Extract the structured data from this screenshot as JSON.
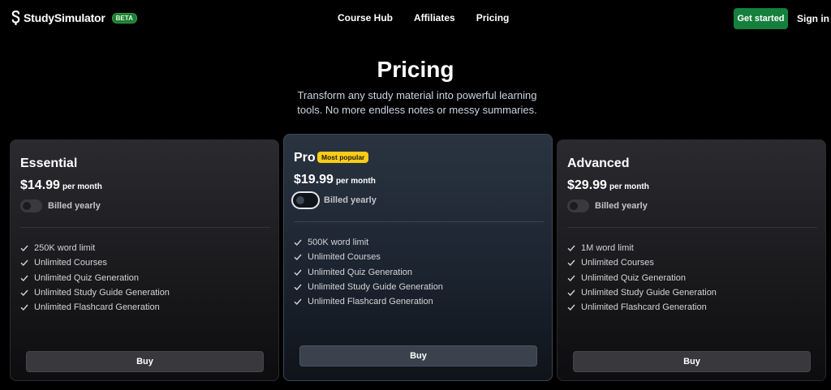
{
  "header": {
    "logo_text": "StudySimulator",
    "beta_label": "BETA",
    "nav": [
      "Course Hub",
      "Affiliates",
      "Pricing"
    ],
    "get_started": "Get started",
    "sign_in": "Sign in"
  },
  "hero": {
    "title": "Pricing",
    "subtitle": "Transform any study material into powerful learning tools. No more endless notes or messy summaries."
  },
  "plans": [
    {
      "name": "Essential",
      "price": "$14.99",
      "period": "per month",
      "billing_label": "Billed yearly",
      "billed_yearly": false,
      "features": [
        "250K word limit",
        "Unlimited Courses",
        "Unlimited Quiz Generation",
        "Unlimited Study Guide Generation",
        "Unlimited Flashcard Generation"
      ],
      "buy_label": "Buy"
    },
    {
      "name": "Pro",
      "badge": "Most popular",
      "price": "$19.99",
      "period": "per month",
      "billing_label": "Billed yearly",
      "billed_yearly": false,
      "features": [
        "500K word limit",
        "Unlimited Courses",
        "Unlimited Quiz Generation",
        "Unlimited Study Guide Generation",
        "Unlimited Flashcard Generation"
      ],
      "buy_label": "Buy"
    },
    {
      "name": "Advanced",
      "price": "$29.99",
      "period": "per month",
      "billing_label": "Billed yearly",
      "billed_yearly": false,
      "features": [
        "1M word limit",
        "Unlimited Courses",
        "Unlimited Quiz Generation",
        "Unlimited Study Guide Generation",
        "Unlimited Flashcard Generation"
      ],
      "buy_label": "Buy"
    }
  ],
  "colors": {
    "accent_green": "#15803d",
    "badge_yellow": "#facc15",
    "background": "#000000"
  },
  "icons": {
    "logo": "s-logo-icon",
    "check": "check-icon"
  }
}
